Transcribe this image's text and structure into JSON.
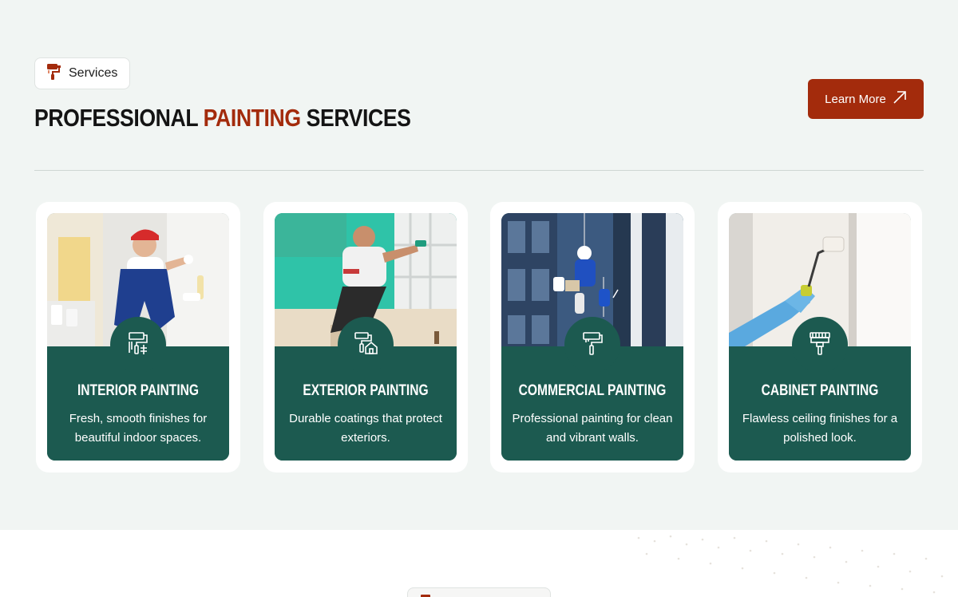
{
  "header": {
    "badge_label": "Services",
    "title_pre": "Professional ",
    "title_accent": "Painting",
    "title_post": " Services",
    "learn_more_label": "Learn More"
  },
  "colors": {
    "accent": "#a32b0c",
    "card_green": "#1c5a50",
    "background": "#f1f5f3"
  },
  "services": [
    {
      "title": "Interior Painting",
      "description": "Fresh, smooth finishes for beautiful indoor spaces.",
      "icon": "paint-roller-wall-icon"
    },
    {
      "title": "Exterior Painting",
      "description": "Durable coatings that protect exteriors.",
      "icon": "paint-roller-house-icon"
    },
    {
      "title": "Commercial Painting",
      "description": "Professional painting for clean and vibrant walls.",
      "icon": "paint-roller-icon"
    },
    {
      "title": "Cabinet Painting",
      "description": "Flawless ceiling finishes for a polished look.",
      "icon": "paint-brush-icon"
    }
  ]
}
